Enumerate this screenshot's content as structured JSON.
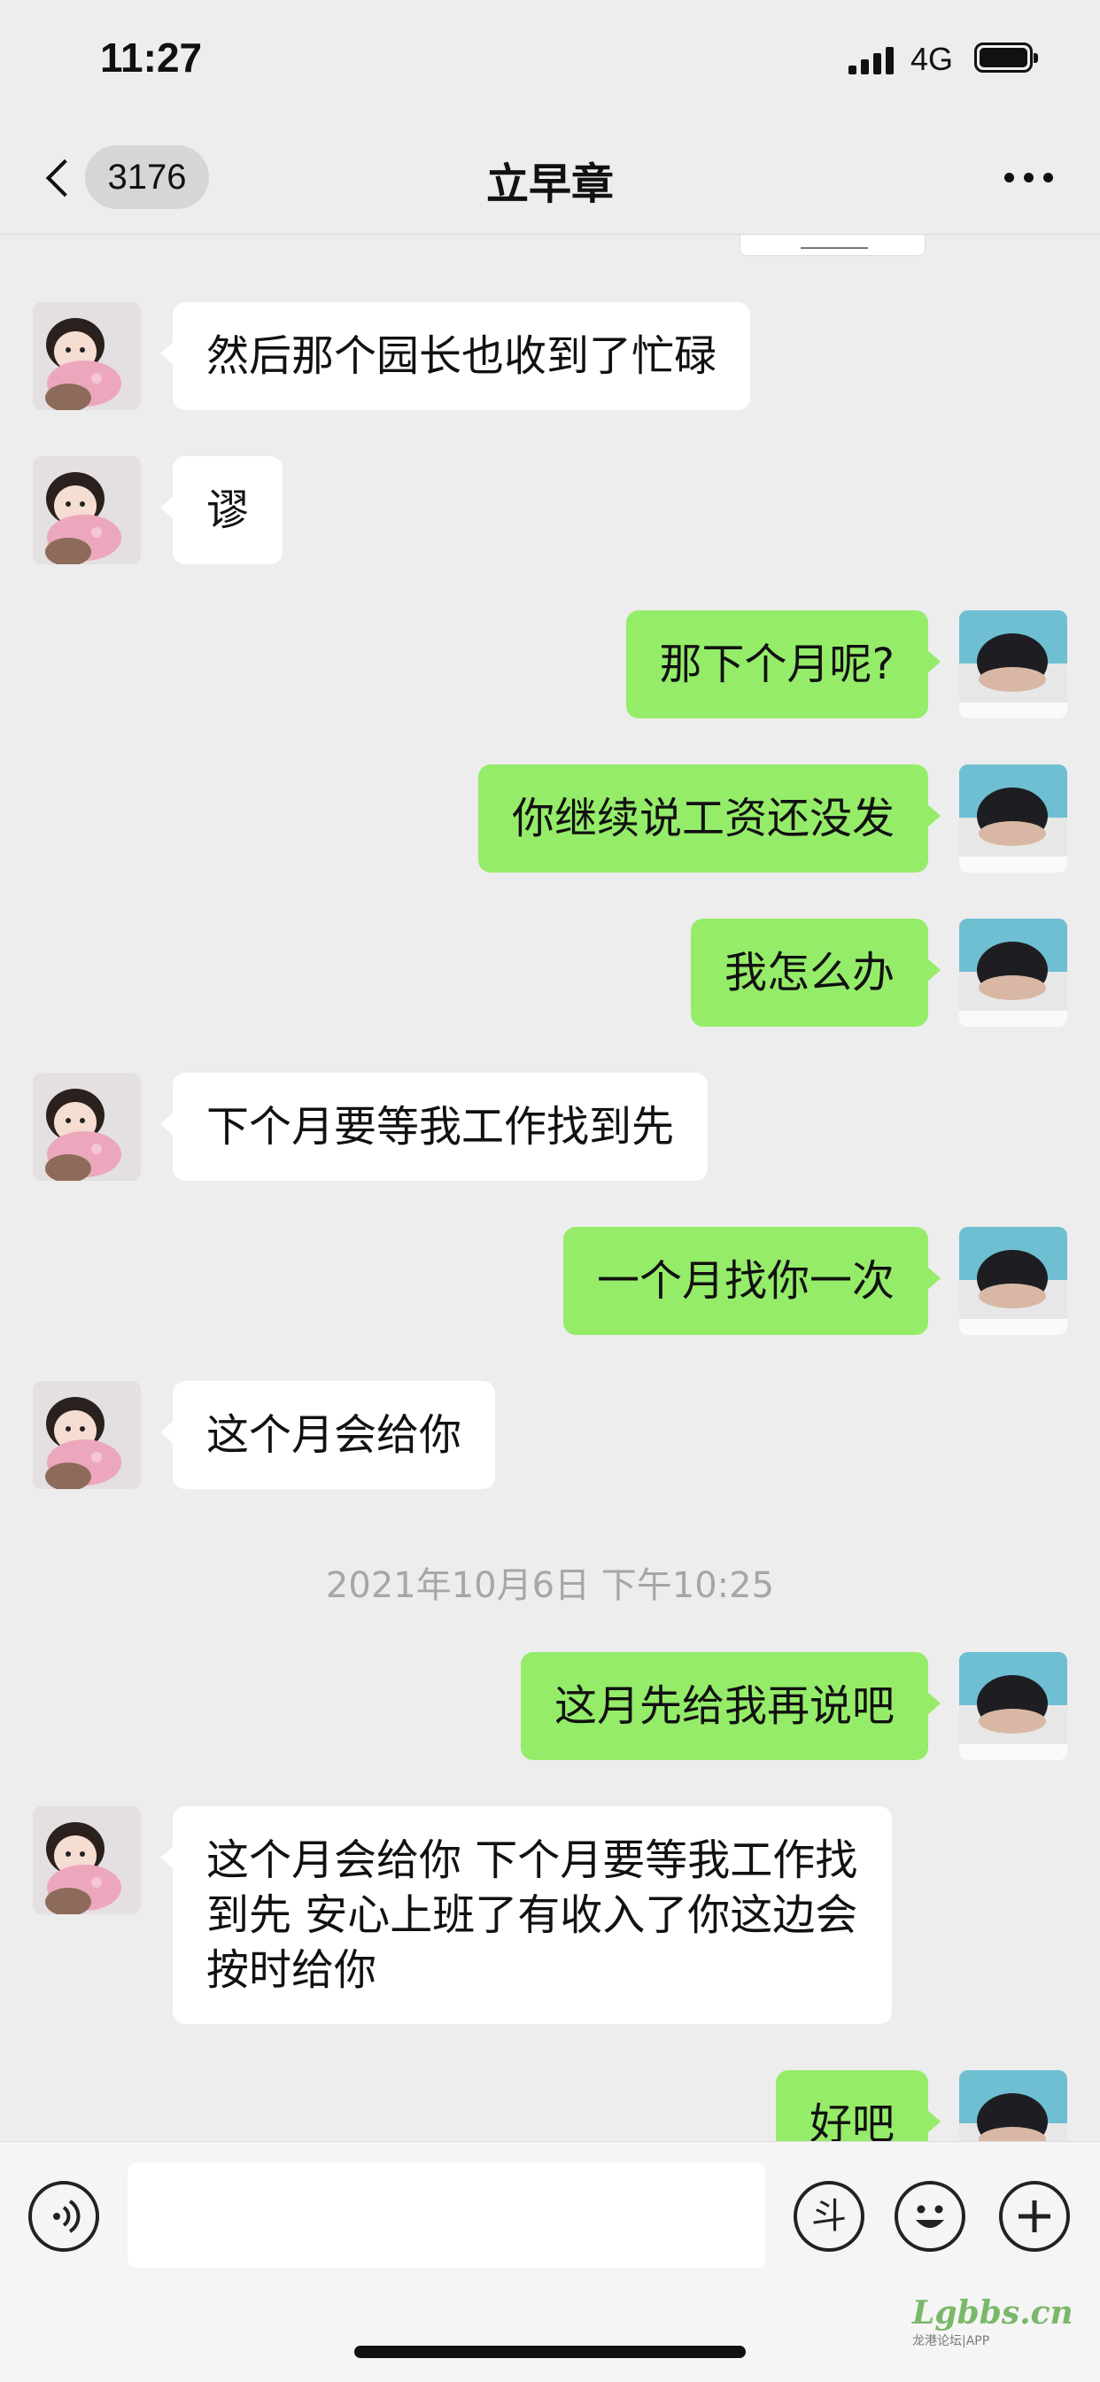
{
  "status_bar": {
    "time": "11:27",
    "network": "4G"
  },
  "nav": {
    "unread_badge": "3176",
    "title": "立早章"
  },
  "messages": [
    {
      "side": "in",
      "text": "然后那个园长也收到了忙碌"
    },
    {
      "side": "in",
      "text": "谬"
    },
    {
      "side": "out",
      "text": "那下个月呢?"
    },
    {
      "side": "out",
      "text": "你继续说工资还没发"
    },
    {
      "side": "out",
      "text": "我怎么办"
    },
    {
      "side": "in",
      "text": "下个月要等我工作找到先"
    },
    {
      "side": "out",
      "text": "一个月找你一次"
    },
    {
      "side": "in",
      "text": "这个月会给你"
    },
    {
      "side": "out",
      "text": "这月先给我再说吧"
    },
    {
      "side": "in",
      "text": "这个月会给你 下个月要等我工作找到先 安心上班了有收入了你这边会按时给你"
    },
    {
      "side": "out",
      "text": "好吧"
    }
  ],
  "timestamp": "2021年10月6日 下午10:25",
  "input_bar": {
    "message_value": "",
    "sticker_label": "斗"
  },
  "watermark": {
    "logo": "Lgbbs.cn",
    "sub": "龙港论坛|APP"
  },
  "colors": {
    "background": "#ededed",
    "outgoing_bubble": "#95ec69",
    "incoming_bubble": "#ffffff"
  }
}
